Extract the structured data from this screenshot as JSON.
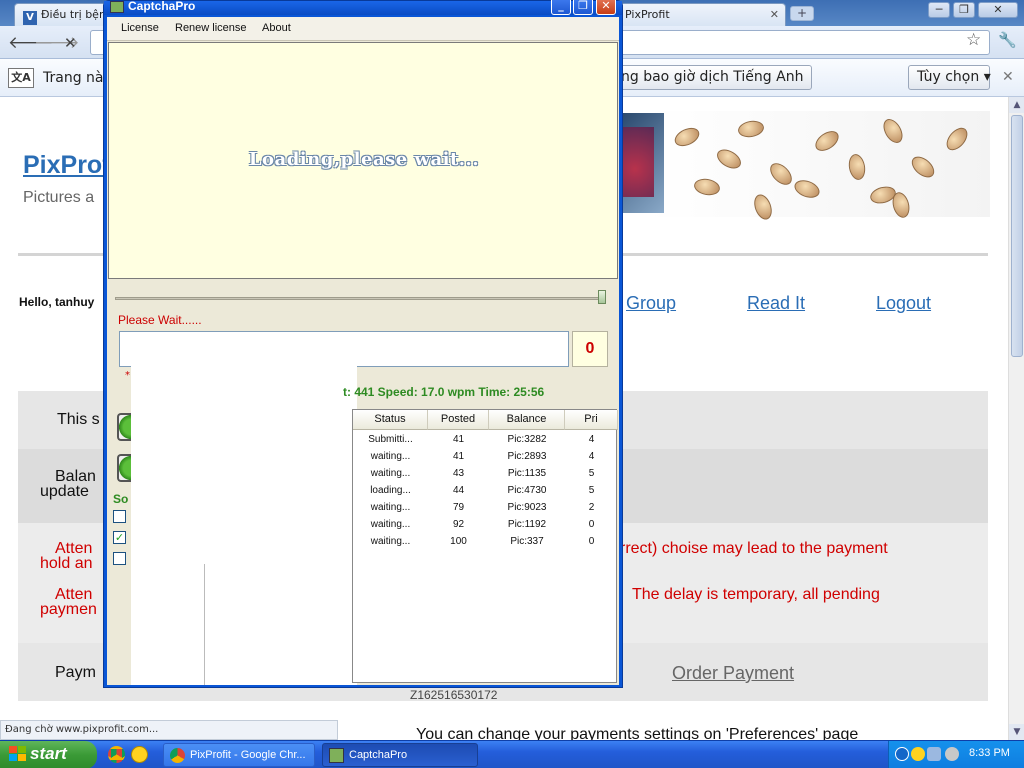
{
  "browser": {
    "tabs": [
      {
        "label": "Điều trị bệnh ...",
        "favicon": "V"
      },
      {
        "label": "PixProfit",
        "close": "✕"
      }
    ],
    "new_tab_icon": "+",
    "window_controls": [
      "─",
      "❐",
      "✕"
    ],
    "nav": {
      "back": "🡐",
      "forward": "🡒",
      "stop": "✕"
    },
    "bookmark_icon": "☆",
    "wrench_icon": "🔧"
  },
  "infobar": {
    "icon_text": "文A",
    "text": "Trang này",
    "never_translate_button": "ng bao giờ dịch Tiếng Anh",
    "options_button": "Tùy chọn ▾",
    "close": "✕"
  },
  "page": {
    "logo": "PixProf",
    "tagline": "Pictures a",
    "hello": "Hello, tanhuy",
    "nav_links": [
      "Group",
      "Read It",
      "Logout"
    ],
    "this_text": "This s",
    "balance_line1": "Balan",
    "balance_line2": "update",
    "attention1_left": "Atten",
    "attention1_left2": "hold an",
    "attention1_right": "rrect) choise may lead to the payment",
    "attention2_left": "Atten",
    "attention2_left2": "paymen",
    "attention2_right": "The  delay  is  temporary,  all  pending",
    "payment_label": "Paym",
    "order_payment": "Order Payment",
    "code": "Z162516530172",
    "preferences_text": "You can change your payments settings on 'Preferences' page"
  },
  "status_bubble": "Đang chờ www.pixprofit.com...",
  "captcha": {
    "title": "CaptchaPro",
    "title_buttons": [
      "_",
      "❐",
      "✕"
    ],
    "menu": [
      "License",
      "Renew license",
      "About"
    ],
    "loading_text": "Loading,please wait...",
    "wait_text": "Please Wait......",
    "count": "0",
    "stats": "t: 441     Speed: 17.0 wpm  Time: 25:56",
    "so_label": "So",
    "table": {
      "headers": [
        "Status",
        "Posted",
        "Balance",
        "Pri"
      ],
      "rows": [
        [
          "Submitti...",
          "41",
          "Pic:3282",
          "4"
        ],
        [
          "waiting...",
          "41",
          "Pic:2893",
          "4"
        ],
        [
          "waiting...",
          "43",
          "Pic:1135",
          "5"
        ],
        [
          "loading...",
          "44",
          "Pic:4730",
          "5"
        ],
        [
          "waiting...",
          "79",
          "Pic:9023",
          "2"
        ],
        [
          "waiting...",
          "92",
          "Pic:1192",
          "0"
        ],
        [
          "waiting...",
          "100",
          "Pic:337",
          "0"
        ]
      ]
    },
    "checkboxes": [
      false,
      true,
      false
    ]
  },
  "taskbar": {
    "start": "start",
    "tasks": [
      {
        "label": "PixProfit - Google Chr...",
        "active": false
      },
      {
        "label": "CaptchaPro",
        "active": true
      }
    ],
    "clock": "8:33 PM"
  },
  "colors": {
    "link_blue": "#2a6db5",
    "warning_red": "#d00000",
    "stats_green": "#2e8b22",
    "xp_blue": "#0a56d6"
  }
}
